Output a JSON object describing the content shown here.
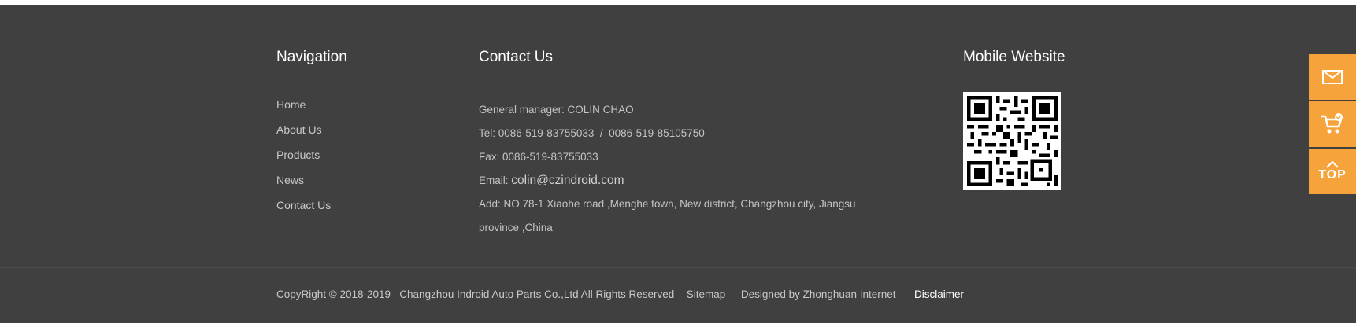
{
  "navigation": {
    "title": "Navigation",
    "items": [
      {
        "label": "Home"
      },
      {
        "label": "About Us"
      },
      {
        "label": "Products"
      },
      {
        "label": "News"
      },
      {
        "label": "Contact Us"
      }
    ]
  },
  "contact": {
    "title": "Contact Us",
    "manager": "General manager: COLIN CHAO",
    "tel": "Tel: 0086-519-83755033  /  0086-519-85105750",
    "fax": "Fax: 0086-519-83755033",
    "email_label": "Email: ",
    "email_value": "colin@czindroid.com",
    "address_line1": "Add: NO.78-1 Xiaohe road ,Menghe town, New district, Changzhou city, Jiangsu",
    "address_line2": "province ,China"
  },
  "mobile": {
    "title": "Mobile Website"
  },
  "footer": {
    "copyright": "CopyRight © 2018-2019   Changzhou Indroid Auto Parts Co.,Ltd All Rights Reserved",
    "sitemap": "Sitemap",
    "designed_by": "Designed by Zhonghuan Internet",
    "disclaimer": "Disclaimer"
  },
  "side_bar": {
    "top_label": "TOP",
    "icons": [
      "envelope-icon",
      "cart-icon",
      "chevron-up-icon"
    ],
    "accent_color": "#f7a33b"
  },
  "colors": {
    "background": "#404040"
  }
}
